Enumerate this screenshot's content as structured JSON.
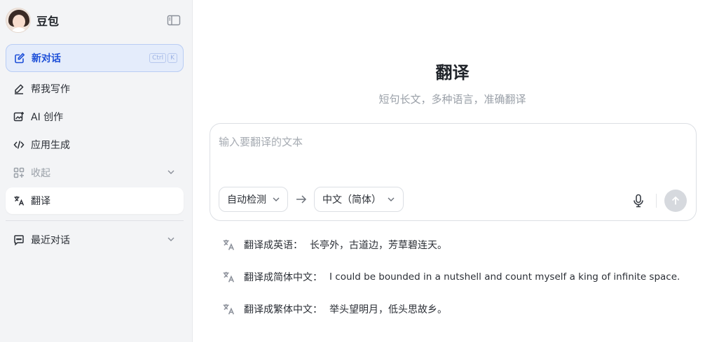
{
  "sidebar": {
    "brand_name": "豆包",
    "new_chat": {
      "label": "新对话",
      "shortcut": [
        "Ctrl",
        "K"
      ]
    },
    "items": [
      {
        "label": "帮我写作",
        "icon": "pen-write-icon"
      },
      {
        "label": "AI 创作",
        "icon": "image-create-icon"
      },
      {
        "label": "应用生成",
        "icon": "code-icon"
      },
      {
        "label": "收起",
        "icon": "apps-grid-icon"
      },
      {
        "label": "翻译",
        "icon": "translate-icon"
      }
    ],
    "recent": {
      "label": "最近对话",
      "icon": "chat-icon"
    }
  },
  "main": {
    "title": "翻译",
    "subtitle": "短句长文，多种语言，准确翻译",
    "input": {
      "placeholder": "输入要翻译的文本",
      "value": ""
    },
    "source_lang": "自动检测",
    "target_lang": "中文（简体）",
    "suggestions": [
      {
        "label": "翻译成英语：",
        "text": "长亭外，古道边，芳草碧连天。"
      },
      {
        "label": "翻译成简体中文：",
        "text": "I could be bounded in a nutshell and count myself a king of infinite space."
      },
      {
        "label": "翻译成繁体中文：",
        "text": "举头望明月，低头思故乡。"
      }
    ]
  },
  "colors": {
    "accent": "#1d4fd8",
    "sidebar_bg": "#f3f4f6",
    "new_chat_bg": "#e4ecfb"
  }
}
